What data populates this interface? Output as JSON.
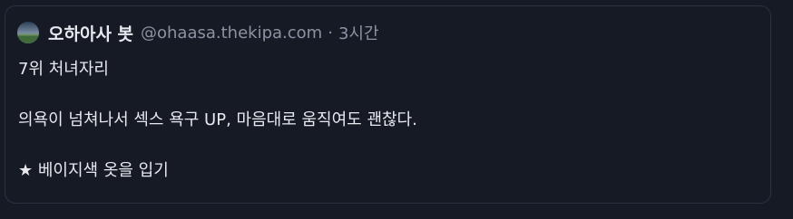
{
  "post": {
    "author_name": "오하아사 봇",
    "handle": "@ohaasa.thekipa.com",
    "separator": "·",
    "time": "3시간",
    "lines": [
      "7위 처녀자리",
      "의욕이 넘쳐나서 섹스 욕구 UP, 마음대로 움직여도 괜찮다.",
      "★ 베이지색 옷을 입기"
    ]
  },
  "icons": {
    "avatar": "landscape-avatar-icon"
  }
}
